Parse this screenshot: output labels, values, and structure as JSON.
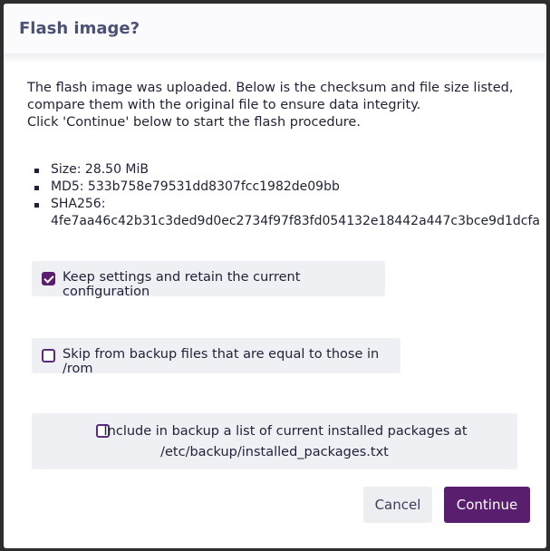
{
  "dialog": {
    "title": "Flash image?",
    "intro_lines": [
      "The flash image was uploaded. Below is the checksum and file size listed,",
      "compare them with the original file to ensure data integrity.",
      "Click 'Continue' below to start the flash procedure."
    ],
    "info": {
      "size": "Size: 28.50 MiB",
      "md5": "MD5: 533b758e79531dd8307fcc1982de09bb",
      "sha256_label": "SHA256:",
      "sha256_value": "4fe7aa46c42b31c3ded9d0ec2734f97f83fd054132e18442a447c3bce9d1dcfa"
    },
    "options": {
      "keep_settings": {
        "label": "Keep settings and retain the current configuration",
        "checked": true
      },
      "skip_backup": {
        "label": "Skip from backup files that are equal to those in /rom",
        "checked": false
      },
      "include_packages": {
        "label_line1": "Include in backup a list of current installed packages at",
        "label_line2": "/etc/backup/installed_packages.txt",
        "checked": false
      }
    },
    "buttons": {
      "cancel": "Cancel",
      "continue": "Continue"
    }
  },
  "colors": {
    "accent": "#5a1e6e",
    "title": "#4a5175",
    "option_bg": "#eef0f4"
  }
}
